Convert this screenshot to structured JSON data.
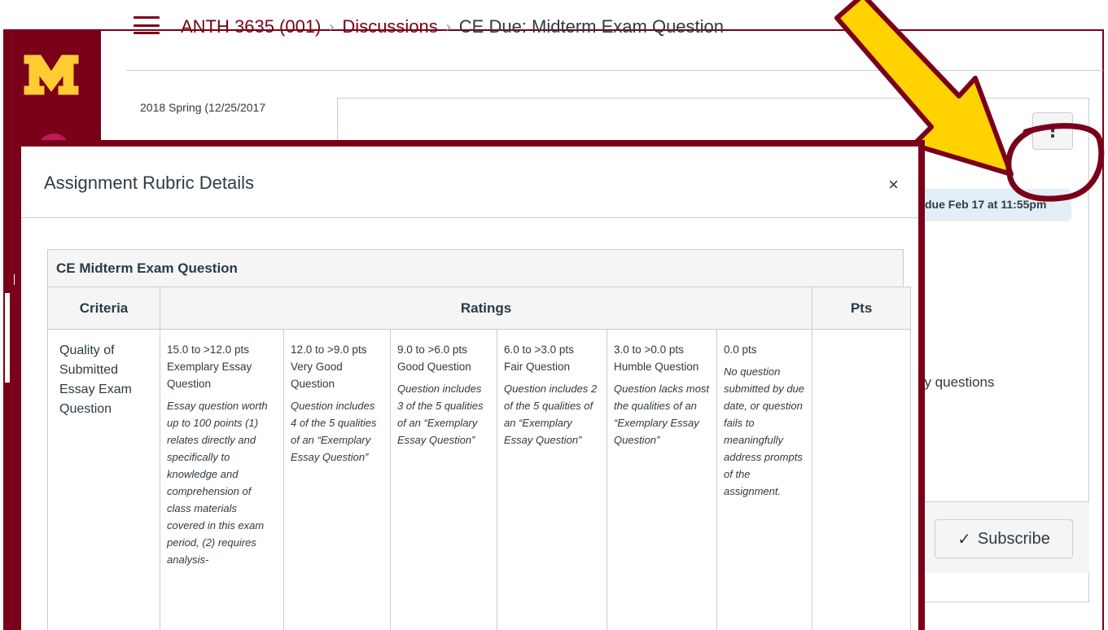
{
  "breadcrumb": {
    "course": "ANTH 3635 (001)",
    "section": "Discussions",
    "current": "CE Due: Midterm Exam Question",
    "separator": "›"
  },
  "term_text": "2018 Spring (12/25/2017",
  "due_text": "due Feb 17 at 11:55pm",
  "body_fragment": "dy questions",
  "subscribe": {
    "check_icon": "✓",
    "label": "Subscribe"
  },
  "kebab_icon": "⋮",
  "modal": {
    "title": "Assignment Rubric Details",
    "close_icon": "×"
  },
  "rubric": {
    "title": "CE Midterm Exam Question",
    "headers": {
      "criteria": "Criteria",
      "ratings": "Ratings",
      "pts": "Pts"
    },
    "criterion": "Quality of Submitted Essay Exam Question",
    "ratings": [
      {
        "points": "15.0 to >12.0 pts",
        "title": "Exemplary Essay Question",
        "description": "Essay question worth up to 100 points (1) relates directly and specifically to knowledge and comprehension of class materials covered in this exam period, (2) requires analysis-"
      },
      {
        "points": "12.0 to >9.0 pts",
        "title": "Very Good Question",
        "description": "Question includes 4 of the 5 qualities of an “Exemplary Essay Question”"
      },
      {
        "points": "9.0 to >6.0 pts",
        "title": "Good Question",
        "description": "Question includes 3 of the 5 qualities of an “Exemplary Essay Question”"
      },
      {
        "points": "6.0 to >3.0 pts",
        "title": "Fair Question",
        "description": "Question includes 2 of the 5 qualities of an “Exemplary Essay Question”"
      },
      {
        "points": "3.0 to >0.0 pts",
        "title": "Humble Question",
        "description": "Question lacks most the qualities of an “Exemplary Essay Question”"
      },
      {
        "points": "0.0 pts",
        "title": "",
        "description": "No question submitted by due date, or question fails to meaningfully address prompts of the assignment."
      }
    ],
    "pts_value": ""
  },
  "colors": {
    "brand_maroon": "#7a0019",
    "brand_gold": "#ffcc33",
    "annotation_yellow": "#ffd200"
  }
}
